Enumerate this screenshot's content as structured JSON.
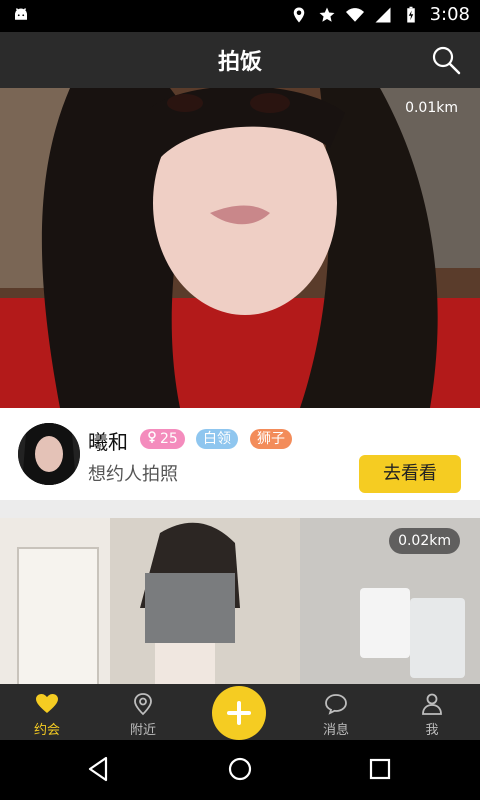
{
  "status_bar": {
    "time": "3:08"
  },
  "header": {
    "title": "拍饭"
  },
  "cards": [
    {
      "distance": "0.01km",
      "name": "曦和",
      "age": "25",
      "job": "白领",
      "sign": "狮子",
      "subtitle": "想约人拍照",
      "cta": "去看看"
    },
    {
      "distance": "0.02km"
    }
  ],
  "bottom_nav": {
    "date": "约会",
    "nearby": "附近",
    "messages": "消息",
    "me": "我"
  },
  "colors": {
    "accent": "#f5cc22",
    "dark": "#2b2b2b",
    "pink": "#f48cbd",
    "blue": "#8fc6ef",
    "orange": "#f38c5a"
  }
}
